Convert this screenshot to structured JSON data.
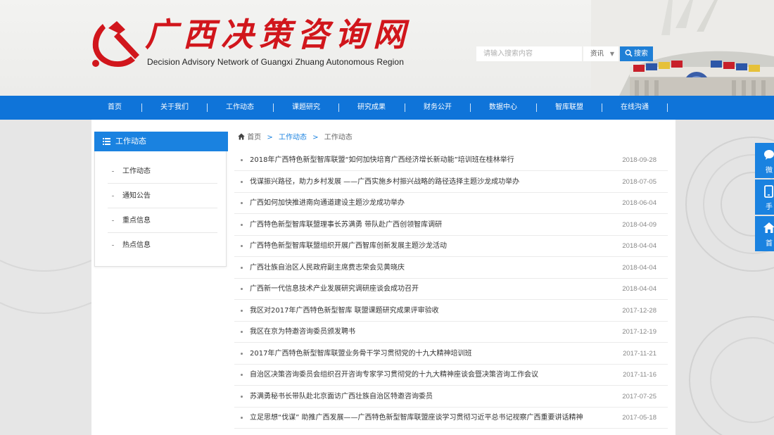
{
  "site": {
    "title": "广西决策咨询网",
    "subtitle": "Decision Advisory Network of Guangxi Zhuang Autonomous Region"
  },
  "search": {
    "placeholder": "请输入搜索内容",
    "select_value": "资讯",
    "button_label": "搜索"
  },
  "nav": [
    {
      "label": "首页"
    },
    {
      "label": "关于我们"
    },
    {
      "label": "工作动态"
    },
    {
      "label": "课题研究"
    },
    {
      "label": "研究成果"
    },
    {
      "label": "财务公开"
    },
    {
      "label": "数据中心"
    },
    {
      "label": "智库联盟"
    },
    {
      "label": "在线沟通"
    }
  ],
  "sidebar": {
    "header": "工作动态",
    "items": [
      {
        "label": "工作动态"
      },
      {
        "label": "通知公告"
      },
      {
        "label": "重点信息"
      },
      {
        "label": "热点信息"
      }
    ]
  },
  "breadcrumb": {
    "home": "首页",
    "section": "工作动态",
    "current": "工作动态"
  },
  "news": [
    {
      "title": "2018年广西特色新型智库联盟“如何加快培育广西经济增长新动能”培训班在桂林举行",
      "date": "2018-09-28"
    },
    {
      "title": "伐谋振兴路径，助力乡村发展 ——广西实施乡村振兴战略的路径选择主题沙龙成功举办",
      "date": "2018-07-05"
    },
    {
      "title": "广西如何加快推进南向通道建设主题沙龙成功举办",
      "date": "2018-06-04"
    },
    {
      "title": "广西特色新型智库联盟理事长苏满勇 带队赴广西创领智库调研",
      "date": "2018-04-09"
    },
    {
      "title": "广西特色新型智库联盟组织开展广西智库创新发展主题沙龙活动",
      "date": "2018-04-04"
    },
    {
      "title": "广西壮族自治区人民政府副主席费志荣会见黄晓庆",
      "date": "2018-04-04"
    },
    {
      "title": "广西新一代信息技术产业发展研究调研座谈会成功召开",
      "date": "2018-04-04"
    },
    {
      "title": "我区对2017年广西特色新型智库 联盟课题研究成果评审验收",
      "date": "2017-12-28"
    },
    {
      "title": "我区在京为特邀咨询委员颁发聘书",
      "date": "2017-12-19"
    },
    {
      "title": "2017年广西特色新型智库联盟业务骨干学习贯彻党的十九大精神培训班",
      "date": "2017-11-21"
    },
    {
      "title": "自治区决策咨询委员会组织召开咨询专家学习贯彻党的十九大精神座谈会暨决策咨询工作会议",
      "date": "2017-11-16"
    },
    {
      "title": "苏满勇秘书长带队赴北京面访广西壮族自治区特邀咨询委员",
      "date": "2017-07-25"
    },
    {
      "title": "立足思想“伐谋” 助推广西发展——广西特色新型智库联盟座谈学习贯彻习近平总书记视察广西重要讲话精神",
      "date": "2017-05-18"
    }
  ],
  "float_tabs": [
    {
      "label": "微",
      "icon": "chat-icon"
    },
    {
      "label": "手",
      "icon": "mobile-icon"
    },
    {
      "label": "首",
      "icon": "home-icon"
    }
  ],
  "colors": {
    "brand_red": "#d1161c",
    "nav_blue": "#0f74d9",
    "accent_blue": "#1a82e0"
  }
}
